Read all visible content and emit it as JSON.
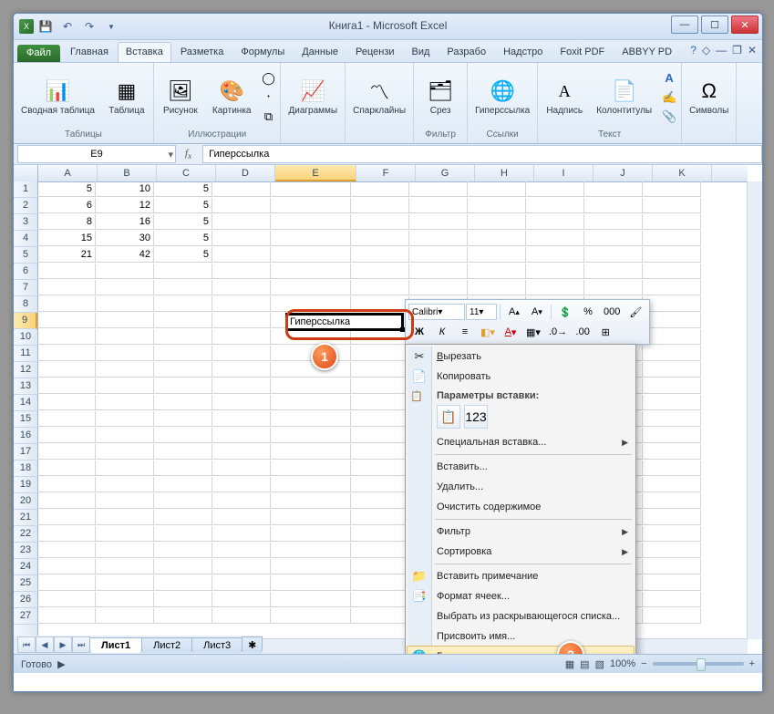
{
  "title": "Книга1  -  Microsoft Excel",
  "tabs": {
    "file": "Файл",
    "home": "Главная",
    "insert": "Вставка",
    "layout": "Разметка",
    "formulas": "Формулы",
    "data": "Данные",
    "review": "Рецензи",
    "view": "Вид",
    "developer": "Разрабо",
    "addins": "Надстро",
    "foxit": "Foxit PDF",
    "abbyy": "ABBYY PD"
  },
  "ribbon": {
    "tables": {
      "pivot": "Сводная\nтаблица",
      "table": "Таблица",
      "group": "Таблицы"
    },
    "illustrations": {
      "picture": "Рисунок",
      "clipart": "Картинка",
      "group": "Иллюстрации"
    },
    "charts": {
      "label": "Диаграммы",
      "group": ""
    },
    "sparklines": {
      "label": "Спарклайны"
    },
    "filter": {
      "slicer": "Срез",
      "group": "Фильтр"
    },
    "links": {
      "hyperlink": "Гиперссылка",
      "group": "Ссылки"
    },
    "text": {
      "textbox": "Надпись",
      "header_footer": "Колонтитулы",
      "group": "Текст"
    },
    "symbols": {
      "label": "Символы"
    }
  },
  "name_box": "E9",
  "fx_value": "Гиперссылка",
  "columns": [
    "A",
    "B",
    "C",
    "D",
    "E",
    "F",
    "G",
    "H",
    "I",
    "J",
    "K"
  ],
  "rows": 27,
  "sel_col": 4,
  "sel_row": 8,
  "grid_data": {
    "0": {
      "0": 5,
      "1": 10,
      "2": 5
    },
    "1": {
      "0": 6,
      "1": 12,
      "2": 5
    },
    "2": {
      "0": 8,
      "1": 16,
      "2": 5
    },
    "3": {
      "0": 15,
      "1": 30,
      "2": 5
    },
    "4": {
      "0": 21,
      "1": 42,
      "2": 5
    }
  },
  "active_cell_value": "Гиперссылка",
  "mini": {
    "font": "Calibri",
    "size": "11",
    "bold": "Ж",
    "italic": "К",
    "sup": "A",
    "sub": "A",
    "percent": "%",
    "thousands": "000"
  },
  "context_menu": {
    "cut": "Вырезать",
    "copy": "Копировать",
    "paste_options": "Параметры вставки:",
    "paste_special": "Специальная вставка...",
    "insert": "Вставить...",
    "delete": "Удалить...",
    "clear": "Очистить содержимое",
    "filter": "Фильтр",
    "sort": "Сортировка",
    "comment": "Вставить примечание",
    "format": "Формат ячеек...",
    "dropdown": "Выбрать из раскрывающегося списка...",
    "name": "Присвоить имя...",
    "hyperlink": "Гиперссылка..."
  },
  "sheets": {
    "s1": "Лист1",
    "s2": "Лист2",
    "s3": "Лист3"
  },
  "status": {
    "ready": "Готово",
    "zoom": "100%"
  },
  "callouts": {
    "c1": "1",
    "c2": "2"
  }
}
